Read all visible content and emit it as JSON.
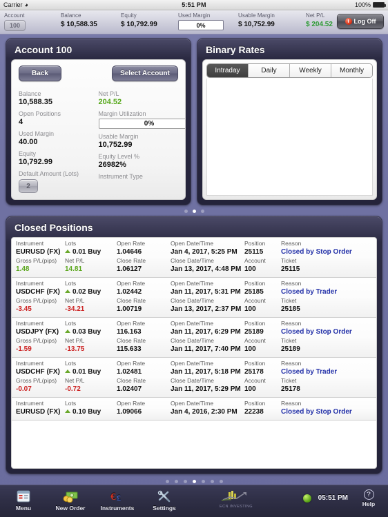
{
  "status_bar": {
    "carrier": "Carrier",
    "wifi_icon": "wifi-icon",
    "time": "5:51 PM",
    "battery_percent": "100%"
  },
  "summary_bar": {
    "cells": [
      {
        "label": "Account",
        "value": "100",
        "type": "pill"
      },
      {
        "label": "Balance",
        "value": "$ 10,588.35",
        "type": "text"
      },
      {
        "label": "Equity",
        "value": "$ 10,792.99",
        "type": "text"
      },
      {
        "label": "Used Margin",
        "value": "0%",
        "type": "input"
      },
      {
        "label": "Usable Margin",
        "value": "$ 10,752.99",
        "type": "text"
      },
      {
        "label": "Net P/L",
        "value": "$ 204.52",
        "type": "text",
        "color": "green"
      }
    ],
    "logoff_label": "Log Off",
    "logoff_icon": "power-icon"
  },
  "account_panel": {
    "title": "Account 100",
    "back_label": "Back",
    "select_account_label": "Select Account",
    "left_fields": [
      {
        "label": "Balance",
        "value": "10,588.35",
        "type": "text"
      },
      {
        "label": "Open Positions",
        "value": "4",
        "type": "text"
      },
      {
        "label": "Used Margin",
        "value": "40.00",
        "type": "text"
      },
      {
        "label": "Equity",
        "value": "10,792.99",
        "type": "text"
      },
      {
        "label": "Default Amount (Lots)",
        "value": "2",
        "type": "button"
      }
    ],
    "right_fields": [
      {
        "label": "Net P/L",
        "value": "204.52",
        "type": "text",
        "color": "green"
      },
      {
        "label": "Margin Utilization",
        "value": "0%",
        "type": "input"
      },
      {
        "label": "Usable Margin",
        "value": "10,752.99",
        "type": "text"
      },
      {
        "label": "Equity Level %",
        "value": "26982%",
        "type": "text"
      },
      {
        "label": "Instrument Type",
        "value": "",
        "type": "text"
      }
    ]
  },
  "binary_rates_panel": {
    "title": "Binary Rates",
    "tabs": [
      {
        "label": "Intraday",
        "active": true
      },
      {
        "label": "Daily",
        "active": false
      },
      {
        "label": "Weekly",
        "active": false
      },
      {
        "label": "Monthly",
        "active": false
      }
    ]
  },
  "panel_pager": {
    "count": 3,
    "active_index": 1
  },
  "closed_positions": {
    "title": "Closed Positions",
    "headers_top": [
      "Instrument",
      "Lots",
      "Open Rate",
      "Open Date/Time",
      "Position",
      "Reason"
    ],
    "headers_bottom": [
      "Gross P/L(pips)",
      "Net P/L",
      "Close Rate",
      "Close Date/Time",
      "Account",
      "Ticket"
    ],
    "rows": [
      {
        "instrument": "EURUSD (FX)",
        "lots": "0.01 Buy",
        "direction_icon": "arrow-up-icon",
        "open_rate": "1.04646",
        "open_datetime": "Jan 4, 2017, 5:25 PM",
        "position": "25115",
        "reason": "Closed by Stop Order",
        "gross_pl": "1.48",
        "net_pl": "14.81",
        "pl_color": "green",
        "close_rate": "1.06127",
        "close_datetime": "Jan 13, 2017, 4:48 PM",
        "account": "100",
        "ticket": "25115"
      },
      {
        "instrument": "USDCHF (FX)",
        "lots": "0.02 Buy",
        "direction_icon": "arrow-up-icon",
        "open_rate": "1.02442",
        "open_datetime": "Jan 11, 2017, 5:31 PM",
        "position": "25185",
        "reason": "Closed by Trader",
        "gross_pl": "-3.45",
        "net_pl": "-34.21",
        "pl_color": "red",
        "close_rate": "1.00719",
        "close_datetime": "Jan 13, 2017, 2:37 PM",
        "account": "100",
        "ticket": "25185"
      },
      {
        "instrument": "USDJPY (FX)",
        "lots": "0.03 Buy",
        "direction_icon": "arrow-up-icon",
        "open_rate": "116.163",
        "open_datetime": "Jan 11, 2017, 6:29 PM",
        "position": "25189",
        "reason": "Closed by Stop Order",
        "gross_pl": "-1.59",
        "net_pl": "-13.75",
        "pl_color": "red",
        "close_rate": "115.633",
        "close_datetime": "Jan 11, 2017, 7:40 PM",
        "account": "100",
        "ticket": "25189"
      },
      {
        "instrument": "USDCHF (FX)",
        "lots": "0.01 Buy",
        "direction_icon": "arrow-up-icon",
        "open_rate": "1.02481",
        "open_datetime": "Jan 11, 2017, 5:18 PM",
        "position": "25178",
        "reason": "Closed by Trader",
        "gross_pl": "-0.07",
        "net_pl": "-0.72",
        "pl_color": "red",
        "close_rate": "1.02407",
        "close_datetime": "Jan 11, 2017, 5:29 PM",
        "account": "100",
        "ticket": "25178"
      },
      {
        "instrument": "EURUSD (FX)",
        "lots": "0.10 Buy",
        "direction_icon": "arrow-up-icon",
        "open_rate": "1.09066",
        "open_datetime": "Jan 4, 2016, 2:30 PM",
        "position": "22238",
        "reason": "Closed by Stop Order",
        "gross_pl": "",
        "net_pl": "",
        "pl_color": "green",
        "close_rate": "",
        "close_datetime": "",
        "account": "",
        "ticket": ""
      }
    ]
  },
  "bottom_pager": {
    "count": 7,
    "active_index": 3
  },
  "toolbar": {
    "items": [
      {
        "label": "Menu",
        "icon": "menu-icon"
      },
      {
        "label": "New Order",
        "icon": "money-icon"
      },
      {
        "label": "Instruments",
        "icon": "currency-icon"
      },
      {
        "label": "Settings",
        "icon": "tools-icon"
      }
    ],
    "logo_text": "ECN INVESTING",
    "logo_icon": "chart-logo-icon",
    "status_dot": "green-status-icon",
    "time": "05:51 PM",
    "help_label": "Help",
    "help_icon": "question-mark-icon"
  },
  "colors": {
    "accent_blue": "#2230a8",
    "positive_green": "#5aa61c",
    "negative_red": "#cc2222",
    "panel_dark": "#24233a",
    "page_bg": "#6f71a2"
  }
}
